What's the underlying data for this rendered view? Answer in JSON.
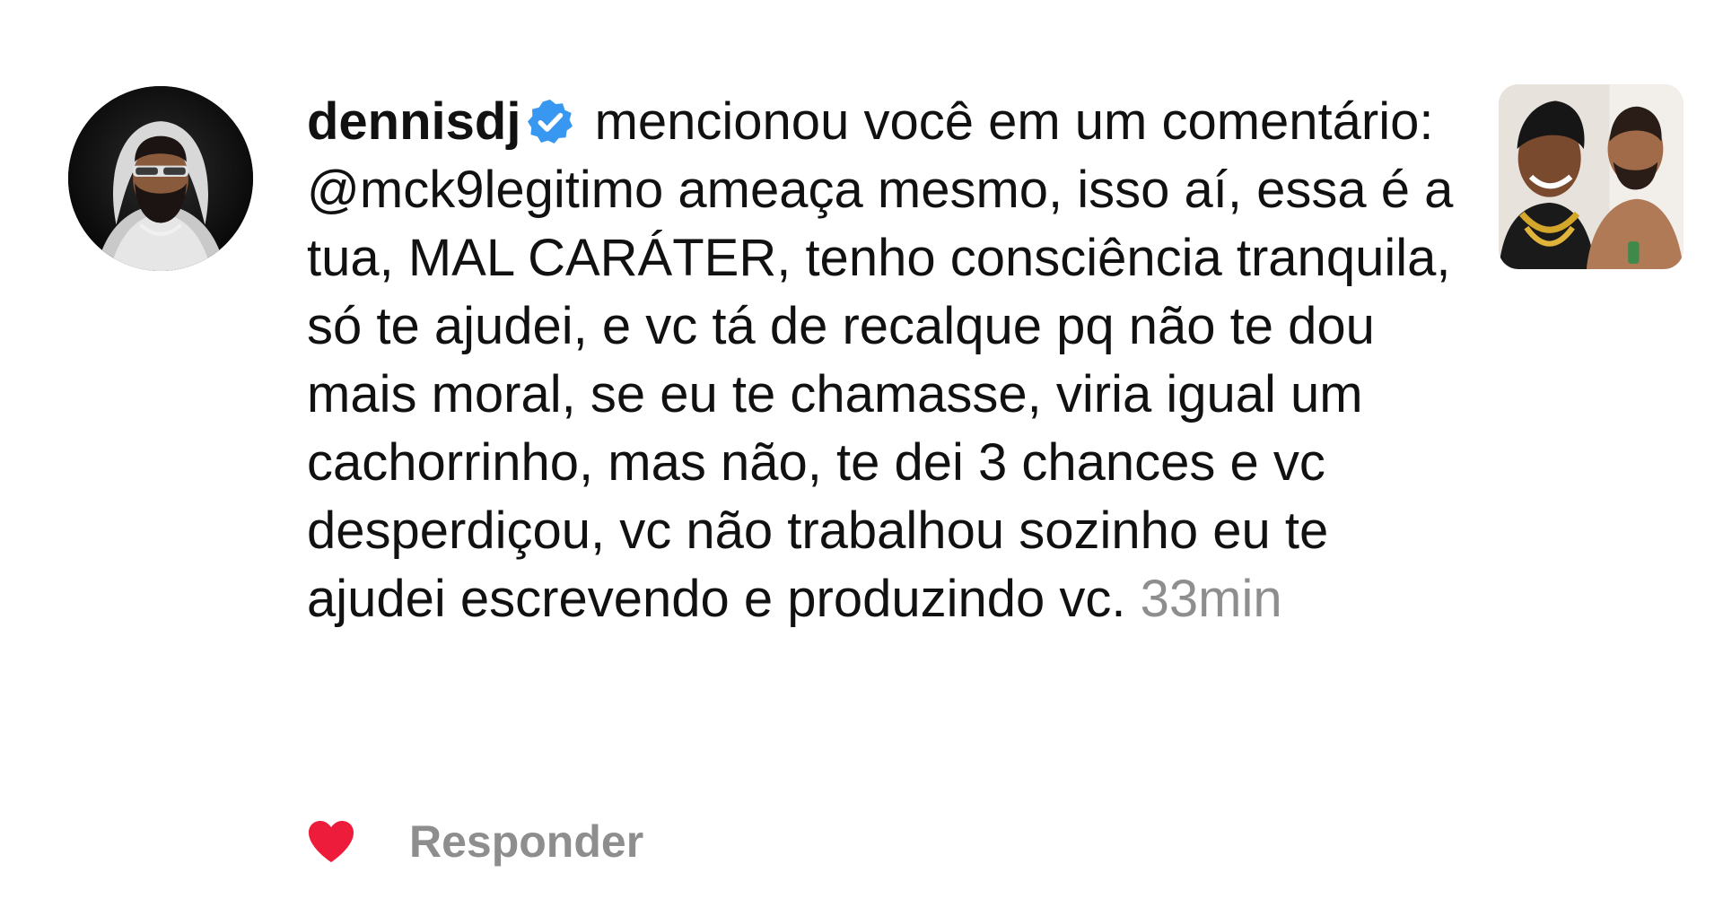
{
  "notification": {
    "username": "dennisdj",
    "verified": true,
    "action_text": " mencionou você em um comentário: ",
    "comment": "@mck9legitimo ameaça mesmo, isso aí, essa é a tua, MAL CARÁTER, tenho consciência tranquila, só te ajudei, e vc tá de recalque pq não te dou mais moral, se eu te chamasse, viria igual um cachorrinho, mas não, te dei 3 chances e vc desperdiçou, vc não trabalhou sozinho eu te ajudei escrevendo e produzindo vc.",
    "time": "33min",
    "liked": true,
    "reply_label": "Responder"
  },
  "icons": {
    "avatar": "profile-avatar",
    "verified": "verified-badge-icon",
    "like": "heart-icon",
    "thumbnail": "post-thumbnail"
  },
  "colors": {
    "verified_blue": "#3897f0",
    "like_red": "#ed1c3a",
    "muted_gray": "#8e8e8e",
    "text": "#111111"
  }
}
